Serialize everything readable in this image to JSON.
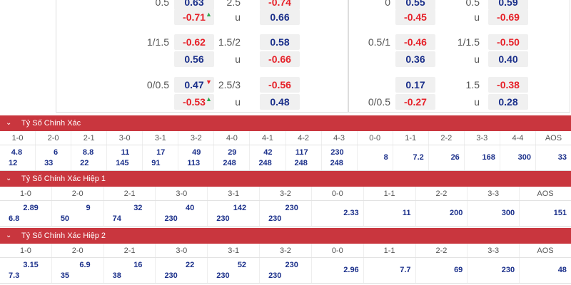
{
  "odds": {
    "left": [
      {
        "label": "0.5",
        "value": "0.63",
        "color": "blue"
      },
      {
        "label": "2.5",
        "value": "-0.74",
        "color": "red"
      },
      {
        "label": "",
        "value": "-0.71",
        "color": "red",
        "arrow": "▲"
      },
      {
        "label": "u",
        "value": "0.66",
        "color": "blue"
      },
      {
        "label": "1/1.5",
        "value": "-0.62",
        "color": "red"
      },
      {
        "label": "1.5/2",
        "value": "0.58",
        "color": "blue"
      },
      {
        "label": "",
        "value": "0.56",
        "color": "blue"
      },
      {
        "label": "u",
        "value": "-0.66",
        "color": "red"
      },
      {
        "label": "0/0.5",
        "value": "0.47",
        "color": "blue",
        "arrow": "▼"
      },
      {
        "label": "2.5/3",
        "value": "-0.56",
        "color": "red"
      },
      {
        "label": "",
        "value": "-0.53",
        "color": "red",
        "arrow": "▲"
      },
      {
        "label": "u",
        "value": "0.48",
        "color": "blue"
      }
    ],
    "right": [
      {
        "label": "0",
        "value": "0.55",
        "color": "blue"
      },
      {
        "label": "0.5",
        "value": "0.59",
        "color": "blue"
      },
      {
        "label": "",
        "value": "-0.45",
        "color": "red"
      },
      {
        "label": "u",
        "value": "-0.69",
        "color": "red"
      },
      {
        "label": "0.5/1",
        "value": "-0.46",
        "color": "red"
      },
      {
        "label": "1/1.5",
        "value": "-0.50",
        "color": "red"
      },
      {
        "label": "",
        "value": "0.36",
        "color": "blue"
      },
      {
        "label": "u",
        "value": "0.40",
        "color": "blue"
      },
      {
        "label": "",
        "value": "0.17",
        "color": "blue"
      },
      {
        "label": "1.5",
        "value": "-0.38",
        "color": "red"
      },
      {
        "label": "0/0.5",
        "value": "-0.27",
        "color": "red"
      },
      {
        "label": "u",
        "value": "0.28",
        "color": "blue"
      }
    ]
  },
  "sections": [
    {
      "title": "Tỷ Số Chính Xác",
      "headers": [
        "1-0",
        "2-0",
        "2-1",
        "3-0",
        "3-1",
        "3-2",
        "4-0",
        "4-1",
        "4-2",
        "4-3",
        "0-0",
        "1-1",
        "2-2",
        "3-3",
        "4-4",
        "AOS"
      ],
      "cells": [
        [
          "4.8",
          "12"
        ],
        [
          "6",
          "33"
        ],
        [
          "8.8",
          "22"
        ],
        [
          "11",
          "145"
        ],
        [
          "17",
          "91"
        ],
        [
          "49",
          "113"
        ],
        [
          "29",
          "248"
        ],
        [
          "42",
          "248"
        ],
        [
          "117",
          "248"
        ],
        [
          "230",
          "248"
        ],
        [
          "8"
        ],
        [
          "7.2"
        ],
        [
          "26"
        ],
        [
          "168"
        ],
        [
          "300"
        ],
        [
          "33"
        ]
      ]
    },
    {
      "title": "Tỷ Số Chính Xác Hiệp 1",
      "headers": [
        "1-0",
        "2-0",
        "2-1",
        "3-0",
        "3-1",
        "3-2",
        "0-0",
        "1-1",
        "2-2",
        "3-3",
        "AOS"
      ],
      "cells": [
        [
          "2.89",
          "6.8"
        ],
        [
          "9",
          "50"
        ],
        [
          "32",
          "74"
        ],
        [
          "40",
          "230"
        ],
        [
          "142",
          "230"
        ],
        [
          "230",
          "230"
        ],
        [
          "2.33"
        ],
        [
          "11"
        ],
        [
          "200"
        ],
        [
          "300"
        ],
        [
          "151"
        ]
      ]
    },
    {
      "title": "Tỷ Số Chính Xác Hiệp 2",
      "headers": [
        "1-0",
        "2-0",
        "2-1",
        "3-0",
        "3-1",
        "3-2",
        "0-0",
        "1-1",
        "2-2",
        "3-3",
        "AOS"
      ],
      "cells": [
        [
          "3.15",
          "7.3"
        ],
        [
          "6.9",
          "35"
        ],
        [
          "16",
          "38"
        ],
        [
          "22",
          "230"
        ],
        [
          "52",
          "230"
        ],
        [
          "230",
          "230"
        ],
        [
          "2.96"
        ],
        [
          "7.7"
        ],
        [
          "69"
        ],
        [
          "230"
        ],
        [
          "48"
        ]
      ]
    }
  ],
  "icons": {
    "chevron": "chevron-down-icon",
    "up_arrow": "up-arrow-icon",
    "down_arrow": "down-arrow-icon"
  },
  "colors": {
    "header_bg": "#c9363e",
    "red_value": "#e6222a",
    "blue_value": "#1a2f8a",
    "up": "#2fa84f"
  }
}
